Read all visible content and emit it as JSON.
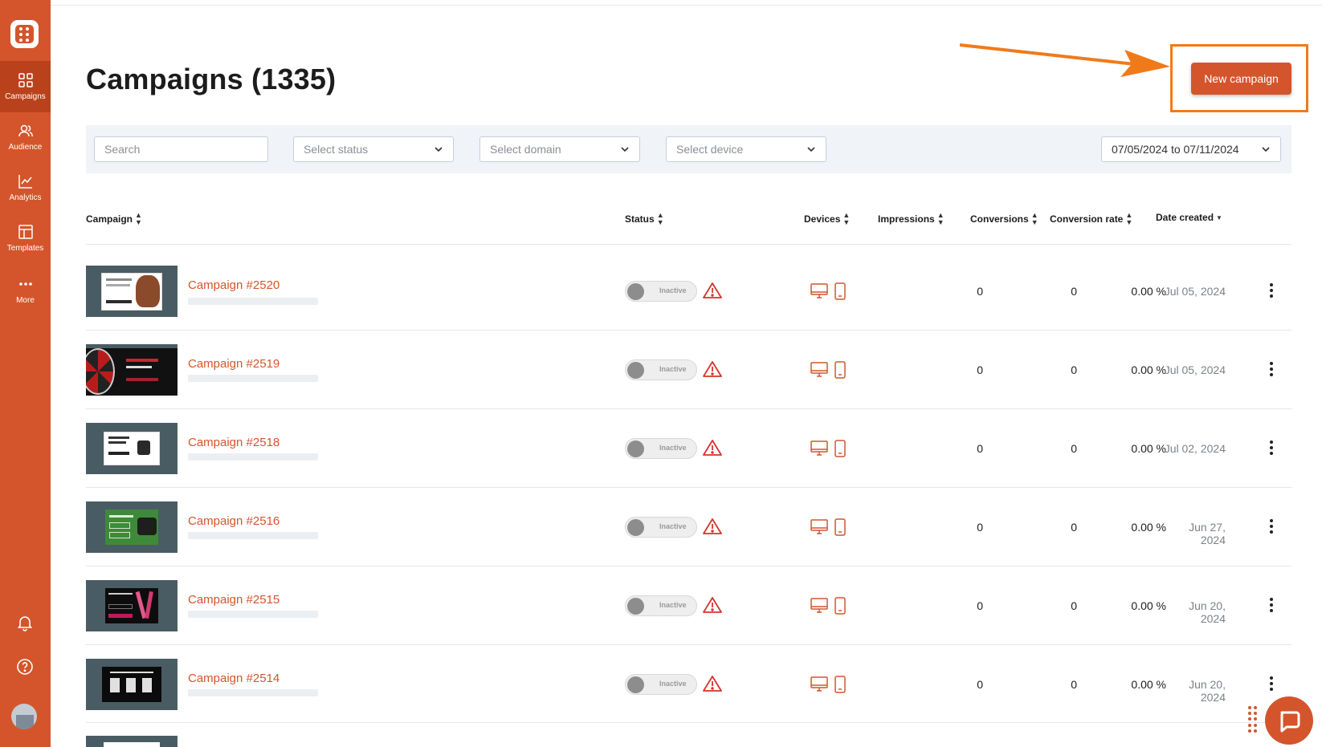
{
  "sidebar": {
    "nav": [
      {
        "label": "Campaigns",
        "icon": "grid-icon",
        "active": true
      },
      {
        "label": "Audience",
        "icon": "users-icon",
        "active": false
      },
      {
        "label": "Analytics",
        "icon": "chart-icon",
        "active": false
      },
      {
        "label": "Templates",
        "icon": "layout-icon",
        "active": false
      },
      {
        "label": "More",
        "icon": "more-icon",
        "active": false
      }
    ],
    "bottom_icons": [
      "bell-icon",
      "help-icon",
      "avatar"
    ]
  },
  "header": {
    "title": "Campaigns (1335)",
    "new_campaign_label": "New campaign"
  },
  "filters": {
    "search_placeholder": "Search",
    "status_placeholder": "Select status",
    "domain_placeholder": "Select domain",
    "device_placeholder": "Select device",
    "date_range": "07/05/2024 to 07/11/2024"
  },
  "table": {
    "columns": {
      "campaign": "Campaign",
      "status": "Status",
      "devices": "Devices",
      "impressions": "Impressions",
      "conversions": "Conversions",
      "conversion_rate": "Conversion rate",
      "date_created": "Date created"
    },
    "rows": [
      {
        "name": "Campaign #2520",
        "status": "Inactive",
        "impressions": "0",
        "conversions": "0",
        "rate": "0.00 %",
        "date": "Jul 05, 2024"
      },
      {
        "name": "Campaign #2519",
        "status": "Inactive",
        "impressions": "0",
        "conversions": "0",
        "rate": "0.00 %",
        "date": "Jul 05, 2024"
      },
      {
        "name": "Campaign #2518",
        "status": "Inactive",
        "impressions": "0",
        "conversions": "0",
        "rate": "0.00 %",
        "date": "Jul 02, 2024"
      },
      {
        "name": "Campaign #2516",
        "status": "Inactive",
        "impressions": "0",
        "conversions": "0",
        "rate": "0.00 %",
        "date": "Jun 27, 2024"
      },
      {
        "name": "Campaign #2515",
        "status": "Inactive",
        "impressions": "0",
        "conversions": "0",
        "rate": "0.00 %",
        "date": "Jun 20, 2024"
      },
      {
        "name": "Campaign #2514",
        "status": "Inactive",
        "impressions": "0",
        "conversions": "0",
        "rate": "0.00 %",
        "date": "Jun 20, 2024"
      }
    ]
  },
  "colors": {
    "brand": "#d4552b",
    "annotation": "#f07a1a",
    "warning": "#d6332c"
  }
}
